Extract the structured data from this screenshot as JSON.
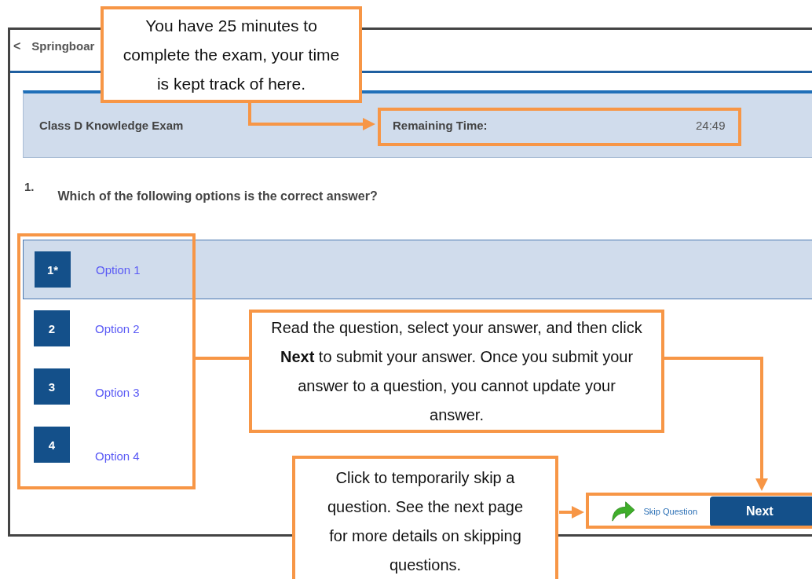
{
  "breadcrumb": {
    "back": "<",
    "label": "Springboar"
  },
  "exam_header": {
    "title": "Class D Knowledge Exam",
    "remaining_label": "Remaining Time:",
    "remaining_time": "24:49"
  },
  "question": {
    "number": "1.",
    "text": "Which of the following options is the correct answer?"
  },
  "options": [
    {
      "number": "1*",
      "label": "Option 1",
      "selected": true
    },
    {
      "number": "2",
      "label": "Option 2",
      "selected": false
    },
    {
      "number": "3",
      "label": "Option 3",
      "selected": false
    },
    {
      "number": "4",
      "label": "Option 4",
      "selected": false
    }
  ],
  "skip_button": "Skip Question",
  "next_button": "Next",
  "callouts": [
    {
      "text": "You have 25 minutes to complete the exam, your time is kept track of here."
    },
    {
      "text": "Read the question, select your answer, and then click **Next** to submit your answer. Once you submit your answer to a question, you cannot update your answer."
    },
    {
      "text": "Click to temporarily skip a question. See the next page for more details on skipping questions."
    }
  ]
}
